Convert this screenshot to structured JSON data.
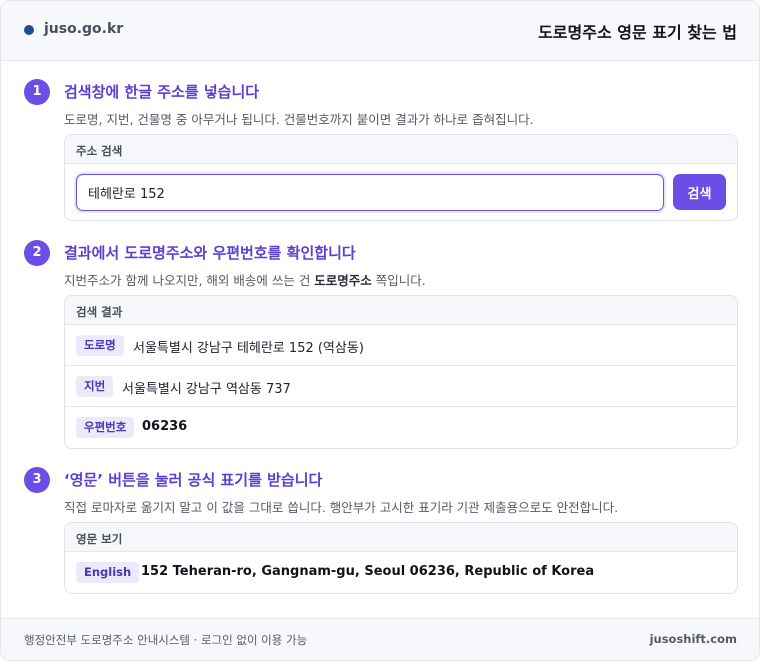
{
  "header": {
    "site": "juso.go.kr",
    "title": "도로명주소 영문 표기 찾는 법"
  },
  "steps": [
    {
      "number": "1",
      "title": "검색창에 한글 주소를 넣습니다",
      "desc": "도로명, 지번, 건물명 중 아무거나 됩니다. 건물번호까지 붙이면 결과가 하나로 좁혀집니다.",
      "card_title": "주소 검색",
      "input_value": "테헤란로 152",
      "button_label": "검색"
    },
    {
      "number": "2",
      "title": "결과에서 도로명주소와 우편번호를 확인합니다",
      "desc_before": "지번주소가 함께 나오지만, 해외 배송에 쓰는 건 ",
      "desc_bold": "도로명주소",
      "desc_after": " 쪽입니다.",
      "card_title": "검색 결과",
      "rows": [
        {
          "tag": "도로명",
          "value": "서울특별시 강남구 테헤란로 152 (역삼동)"
        },
        {
          "tag": "지번",
          "value": "서울특별시 강남구 역삼동 737"
        },
        {
          "tag": "우편번호",
          "value": "06236"
        }
      ]
    },
    {
      "number": "3",
      "title": "‘영문’ 버튼을 눌러 공식 표기를 받습니다",
      "desc": "직접 로마자로 옮기지 말고 이 값을 그대로 씁니다. 행안부가 고시한 표기라 기관 제출용으로도 안전합니다.",
      "card_title": "영문 보기",
      "rows": [
        {
          "tag": "English",
          "value": "152 Teheran-ro, Gangnam-gu, Seoul 06236, Republic of Korea"
        }
      ]
    }
  ],
  "footer": {
    "left": "행정안전부 도로명주소 안내시스템 · 로그인 없이 이용 가능",
    "right": "jusoshift.com"
  },
  "colors": {
    "accent": "#6b4ee6",
    "tag_bg": "#ece9fb",
    "site_dot": "#1f4a9a"
  }
}
